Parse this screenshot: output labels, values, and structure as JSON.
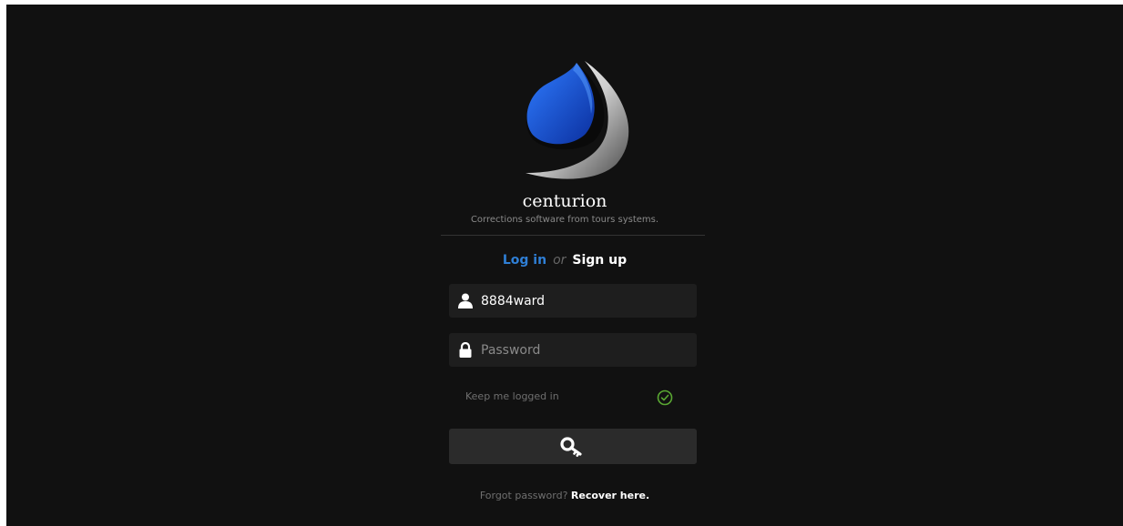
{
  "brand": {
    "name": "centurion",
    "tagline": "Corrections software from tours systems."
  },
  "auth_toggle": {
    "login": "Log in",
    "or": "or",
    "signup": "Sign up"
  },
  "username_field": {
    "value": "8884ward",
    "icon": "user-icon"
  },
  "password_field": {
    "placeholder": "Password",
    "value": "",
    "icon": "lock-icon"
  },
  "keep_logged_in": {
    "label": "Keep me logged in",
    "checked": true,
    "icon": "check-circle-icon"
  },
  "login_button": {
    "icon": "key-icon"
  },
  "forgot": {
    "question": "Forgot password?",
    "link": "Recover here."
  },
  "colors": {
    "background": "#111111",
    "accent": "#2f7fd6",
    "check": "#5aa832"
  }
}
